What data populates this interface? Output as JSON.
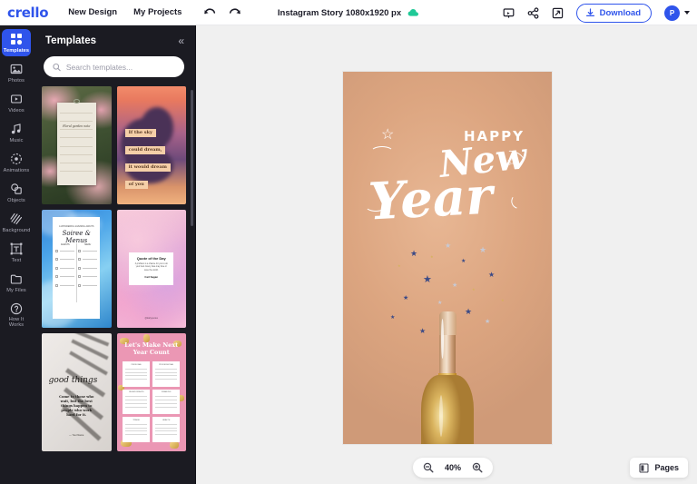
{
  "topbar": {
    "logo": "crello",
    "menu": [
      {
        "label": "New Design",
        "name": "new-design"
      },
      {
        "label": "My Projects",
        "name": "my-projects"
      }
    ],
    "undo_name": "undo-icon",
    "redo_name": "redo-icon",
    "doc_title": "Instagram Story 1080x1920 px",
    "cloud_status_icon": "cloud-saved-icon",
    "cloud_color": "#20c997",
    "present_icon": "present-icon",
    "share_icon": "share-icon",
    "duplicate_icon": "duplicate-icon",
    "download_label": "Download",
    "download_icon": "download-icon",
    "accent_color": "#2f54eb",
    "avatar_initial": "P"
  },
  "rail": {
    "items": [
      {
        "label": "Templates",
        "icon": "templates-icon",
        "active": true
      },
      {
        "label": "Photos",
        "icon": "photos-icon",
        "active": false
      },
      {
        "label": "Videos",
        "icon": "videos-icon",
        "active": false
      },
      {
        "label": "Music",
        "icon": "music-icon",
        "active": false
      },
      {
        "label": "Animations",
        "icon": "animations-icon",
        "active": false
      },
      {
        "label": "Objects",
        "icon": "objects-icon",
        "active": false
      },
      {
        "label": "Background",
        "icon": "background-icon",
        "active": false
      },
      {
        "label": "Text",
        "icon": "text-icon",
        "active": false
      },
      {
        "label": "My Files",
        "icon": "my-files-icon",
        "active": false
      },
      {
        "label": "How It Works",
        "icon": "help-icon",
        "active": false
      }
    ]
  },
  "panel": {
    "title": "Templates",
    "collapse_icon": "collapse-chevron-icon",
    "collapse_glyph": "«",
    "search": {
      "placeholder": "Search templates...",
      "value": "",
      "icon": "search-icon"
    },
    "templates": [
      {
        "name": "template-floral-note",
        "title": "Floral garden note"
      },
      {
        "name": "template-sky-dream",
        "title": "If the sky could dream",
        "lines": [
          "If the sky",
          "could dream,",
          "it would dream",
          "of you"
        ]
      },
      {
        "name": "template-ocean-menu",
        "title": "Soiree & Menus",
        "heading": "Soiree & Menus",
        "subheading": "A WONDERFUL EVENING AWAITS"
      },
      {
        "name": "template-galaxy-quote",
        "title": "Quote of the Day",
        "heading": "Quote of the Day",
        "body": "A problem is a chance for you to do your best. Every idea may lose or save the world.",
        "author": "Carl Sagan",
        "handle": "@dailyquotes"
      },
      {
        "name": "template-good-things",
        "title": "good things",
        "heading": "good things",
        "body": "Come to those who wait, but the best things happen to people who work hard for it.",
        "author": "— Your Name"
      },
      {
        "name": "template-next-year",
        "title": "Let's Make Next Year Count",
        "heading": "Let's Make Next Year Count",
        "boxes": [
          "PERSONAL",
          "PROFESSIONAL",
          "RELATIONSHIPS",
          "FINANCES",
          "TRAVEL",
          "HEALTH"
        ]
      }
    ]
  },
  "canvas": {
    "text_happy": "HAPPY",
    "text_new": "New",
    "text_year": "Year",
    "background_color": "#dfa884",
    "accent_text_color": "#ffffff"
  },
  "footer": {
    "zoom_out_icon": "zoom-out-icon",
    "zoom_in_icon": "zoom-in-icon",
    "zoom_value": "40%",
    "pages_label": "Pages",
    "pages_icon": "pages-icon"
  }
}
